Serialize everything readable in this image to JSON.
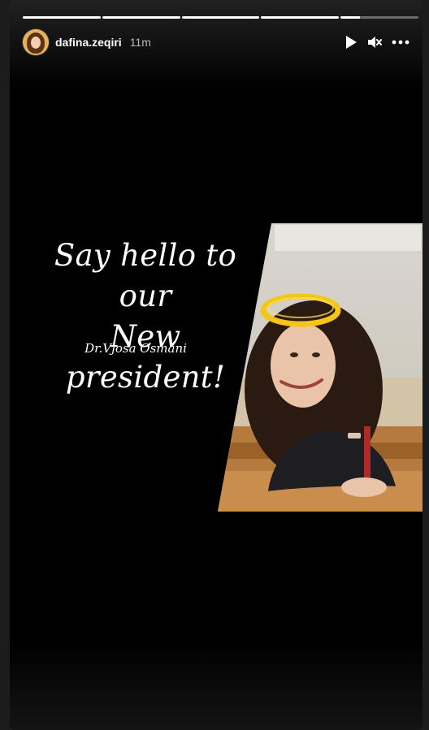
{
  "story": {
    "username": "dafina.zeqiri",
    "time": "11m",
    "progress": [
      1,
      1,
      1,
      1,
      0.25
    ]
  },
  "content": {
    "headline_line1": "Say hello to our",
    "headline_line2": "New president!",
    "name": "Dr.Vjosa Osmani"
  },
  "icons": {
    "play": "play-icon",
    "mute": "mute-icon",
    "more": "more-options-icon"
  },
  "colors": {
    "background": "#000000",
    "halo": "#f5c518"
  }
}
